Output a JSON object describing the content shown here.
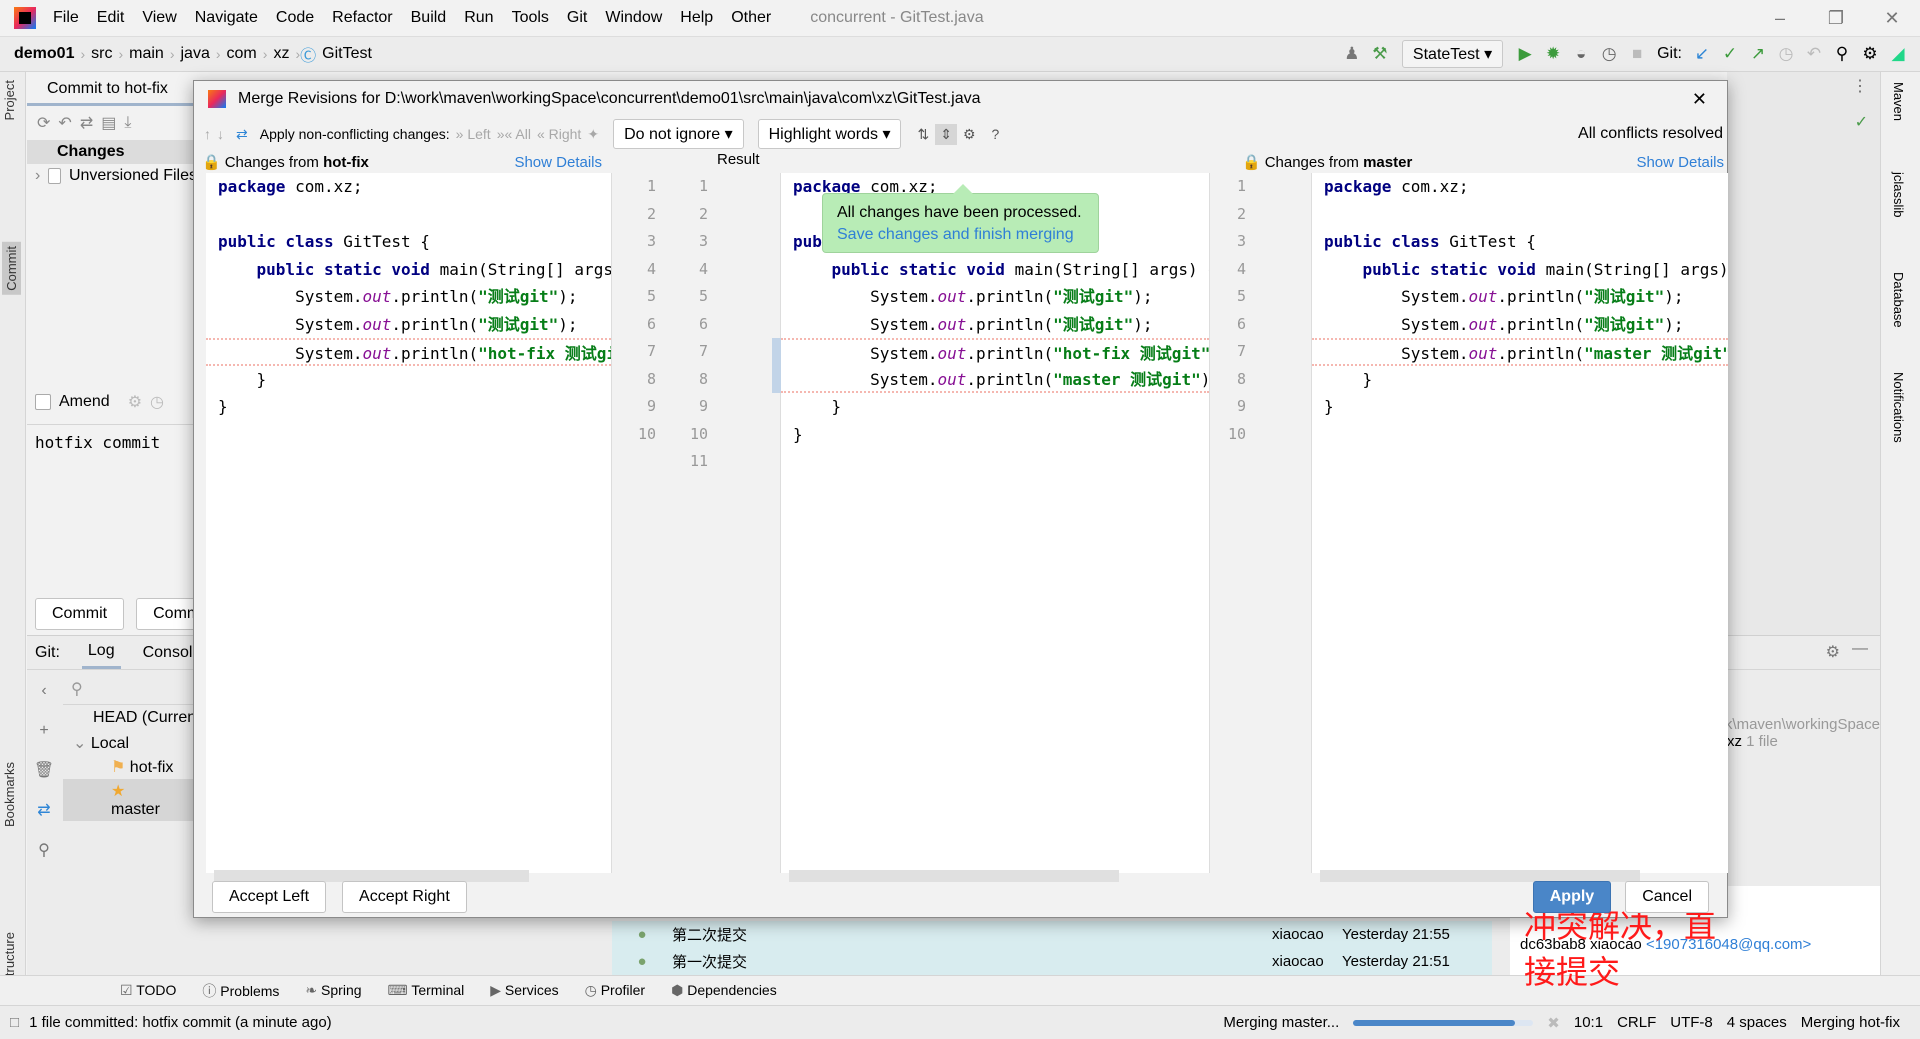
{
  "menubar": {
    "items": [
      "File",
      "Edit",
      "View",
      "Navigate",
      "Code",
      "Refactor",
      "Build",
      "Run",
      "Tools",
      "Git",
      "Window",
      "Help",
      "Other"
    ],
    "title": "concurrent - GitTest.java"
  },
  "breadcrumb": [
    "demo01",
    "src",
    "main",
    "java",
    "com",
    "xz",
    "GitTest"
  ],
  "toolbar": {
    "run_config": "StateTest",
    "git_label": "Git:"
  },
  "left_strip": {
    "project": "Project",
    "commit": "Commit",
    "bookmarks": "Bookmarks",
    "structure": "Structure"
  },
  "right_strip": {
    "maven": "Maven",
    "jclasslib": "jclasslib",
    "database": "Database",
    "notifications": "Notifications"
  },
  "commit_panel": {
    "tab": "Commit to hot-fix",
    "changes_header": "Changes",
    "unversioned": "Unversioned Files",
    "amend": "Amend",
    "message": "hotfix commit",
    "commit_button": "Commit",
    "commit_push_button": "Commit and Push..."
  },
  "git_panel": {
    "label": "Git:",
    "tabs": [
      "Log",
      "Console"
    ],
    "branches": {
      "head": "HEAD (Current Branch)",
      "local": "Local",
      "items": [
        "hot-fix",
        "master"
      ]
    },
    "commits": [
      {
        "msg": "第二次提交",
        "author": "xiaocao",
        "date": "Yesterday 21:55"
      },
      {
        "msg": "第一次提交",
        "author": "xiaocao",
        "date": "Yesterday 21:51"
      }
    ],
    "path": "D:\\work\\maven\\workingSpace",
    "dir": "xz",
    "dir_count": "1 file",
    "detail": "dc63bab8 xiaocao",
    "email": "<1907316048@qq.com>"
  },
  "bottom_tools": [
    "TODO",
    "Problems",
    "Spring",
    "Terminal",
    "Services",
    "Profiler",
    "Dependencies"
  ],
  "status": {
    "message": "1 file committed: hotfix commit (a minute ago)",
    "task": "Merging master...",
    "progress": 0.9,
    "position": "10:1",
    "line_sep": "CRLF",
    "encoding": "UTF-8",
    "indent": "4 spaces",
    "branch": "Merging hot-fix"
  },
  "dialog": {
    "title": "Merge Revisions for D:\\work\\maven\\workingSpace\\concurrent\\demo01\\src\\main\\java\\com\\xz\\GitTest.java",
    "apply_label": "Apply non-conflicting changes:",
    "left": "Left",
    "all": "All",
    "right": "Right",
    "ignore": "Do not ignore",
    "highlight": "Highlight words",
    "status": "All conflicts resolved",
    "left_header": "Changes from",
    "left_branch": "hot-fix",
    "result_header": "Result",
    "right_header": "Changes from",
    "right_branch": "master",
    "show_details": "Show Details",
    "balloon_text": "All changes have been processed.",
    "balloon_link": "Save changes and finish merging",
    "accept_left": "Accept Left",
    "accept_right": "Accept Right",
    "apply": "Apply",
    "cancel": "Cancel"
  },
  "code": {
    "left": [
      [
        [
          "kw",
          "package"
        ],
        [
          "",
          "com.xz;"
        ]
      ],
      [],
      [
        [
          "kw",
          "public class"
        ],
        [
          "",
          "GitTest {"
        ]
      ],
      [
        [
          "",
          "    "
        ],
        [
          "kw",
          "public static void"
        ],
        [
          "",
          "main(String[] args) {"
        ]
      ],
      [
        [
          "",
          "        System."
        ],
        [
          "fld",
          "out"
        ],
        [
          "",
          ".println("
        ],
        [
          "str",
          "\"测试git\""
        ],
        [
          "",
          ");"
        ]
      ],
      [
        [
          "",
          "        System."
        ],
        [
          "fld",
          "out"
        ],
        [
          "",
          ".println("
        ],
        [
          "str",
          "\"测试git\""
        ],
        [
          "",
          ");"
        ]
      ],
      [
        [
          "",
          "        System."
        ],
        [
          "fld",
          "out"
        ],
        [
          "",
          ".println("
        ],
        [
          "str",
          "\"hot-fix 测试git\""
        ],
        [
          "",
          ");"
        ]
      ],
      [
        [
          "",
          "    }"
        ]
      ],
      [
        [
          "",
          "}"
        ]
      ],
      []
    ],
    "result": [
      [
        [
          "kw",
          "package"
        ],
        [
          "",
          "com.xz;"
        ]
      ],
      [],
      [
        [
          "kw",
          "public class"
        ],
        [
          "",
          "GitTest {"
        ]
      ],
      [
        [
          "",
          "    "
        ],
        [
          "kw",
          "public static void"
        ],
        [
          "",
          "main(String[] args) {"
        ]
      ],
      [
        [
          "",
          "        System."
        ],
        [
          "fld",
          "out"
        ],
        [
          "",
          ".println("
        ],
        [
          "str",
          "\"测试git\""
        ],
        [
          "",
          ");"
        ]
      ],
      [
        [
          "",
          "        System."
        ],
        [
          "fld",
          "out"
        ],
        [
          "",
          ".println("
        ],
        [
          "str",
          "\"测试git\""
        ],
        [
          "",
          ");"
        ]
      ],
      [
        [
          "",
          "        System."
        ],
        [
          "fld",
          "out"
        ],
        [
          "",
          ".println("
        ],
        [
          "str",
          "\"hot-fix 测试git\""
        ],
        [
          "",
          ");"
        ]
      ],
      [
        [
          "",
          "        System."
        ],
        [
          "fld",
          "out"
        ],
        [
          "",
          ".println("
        ],
        [
          "str",
          "\"master 测试git\""
        ],
        [
          "",
          ");"
        ]
      ],
      [
        [
          "",
          "    }"
        ]
      ],
      [
        [
          "",
          "}"
        ]
      ],
      []
    ],
    "right": [
      [
        [
          "kw",
          "package"
        ],
        [
          "",
          "com.xz;"
        ]
      ],
      [],
      [
        [
          "kw",
          "public class"
        ],
        [
          "",
          "GitTest {"
        ]
      ],
      [
        [
          "",
          "    "
        ],
        [
          "kw",
          "public static void"
        ],
        [
          "",
          "main(String[] args) {"
        ]
      ],
      [
        [
          "",
          "        System."
        ],
        [
          "fld",
          "out"
        ],
        [
          "",
          ".println("
        ],
        [
          "str",
          "\"测试git\""
        ],
        [
          "",
          ");"
        ]
      ],
      [
        [
          "",
          "        System."
        ],
        [
          "fld",
          "out"
        ],
        [
          "",
          ".println("
        ],
        [
          "str",
          "\"测试git\""
        ],
        [
          "",
          ");"
        ]
      ],
      [
        [
          "",
          "        System."
        ],
        [
          "fld",
          "out"
        ],
        [
          "",
          ".println("
        ],
        [
          "str",
          "\"master 测试git\""
        ],
        [
          "",
          ");"
        ]
      ],
      [
        [
          "",
          "    }"
        ]
      ],
      [
        [
          "",
          "}"
        ]
      ],
      []
    ]
  },
  "annotation": "冲突解决，直接提交",
  "colors": {
    "accent": "#4a86c8",
    "balloon": "#b8ecb6",
    "annotation": "#ff1a1a",
    "conflict": "#f5b7b0"
  }
}
